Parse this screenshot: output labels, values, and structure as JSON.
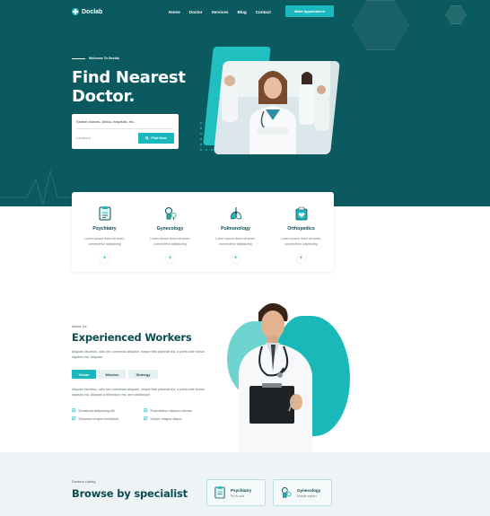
{
  "brand": {
    "name": "Doclab",
    "accent": "#1ab8bc",
    "dark": "#0b5a5f"
  },
  "nav": {
    "items": [
      "Home",
      "Doctor",
      "Services",
      "Blog",
      "Contact"
    ],
    "cta": "Make Appointment"
  },
  "hero": {
    "eyebrow": "Welcome To Doclab",
    "title_line1": "Find Nearest",
    "title_line2": "Doctor.",
    "search_placeholder": "Search doctors, clinics, hospitals, etc.",
    "location_placeholder": "Locations",
    "find_button": "Find Now"
  },
  "features": [
    {
      "name": "Psychiatry",
      "desc_line1": "Lorem ipsum dolor sit amet,",
      "desc_line2": "consectetur adipisicing",
      "icon": "psychiatry-icon"
    },
    {
      "name": "Gynecology",
      "desc_line1": "Lorem ipsum dolor sit amet,",
      "desc_line2": "consectetur adipisicing",
      "icon": "gynecology-icon"
    },
    {
      "name": "Pulmonology",
      "desc_line1": "Lorem ipsum dolor sit amet,",
      "desc_line2": "consectetur adipisicing",
      "icon": "pulmonology-icon"
    },
    {
      "name": "Orthopedics",
      "desc_line1": "Lorem ipsum dolor sit amet,",
      "desc_line2": "consectetur adipisicing",
      "icon": "orthopedics-icon"
    }
  ],
  "about": {
    "eyebrow": "About Us",
    "title": "Experienced Workers",
    "para1": "Aliquam faucibus, odio nec commodo aliquam, neque felis placerat dui, a porta ante lectus dapibus est. Aliquam",
    "tabs": [
      "Vision",
      "Mission",
      "Strategy"
    ],
    "para2": "Aliquam faucibus, odio nec commodo aliquam, neque felis placerat dui, a porta ante lectus dapibus est. Aliquam a bibendum est, sed vestibulum",
    "checks": [
      "Doestoria adipiscing elit",
      "Exercitation ullamco laboris",
      "Eiusmod tempor incididunt",
      "Dolore magna aliqua"
    ]
  },
  "specialists": {
    "eyebrow": "Doctors Listing",
    "title": "Browse by specialist",
    "cards": [
      {
        "name": "Psychiatry",
        "sub": "Pro's unit"
      },
      {
        "name": "Gynecology",
        "sub": "Mobile expert"
      }
    ]
  }
}
